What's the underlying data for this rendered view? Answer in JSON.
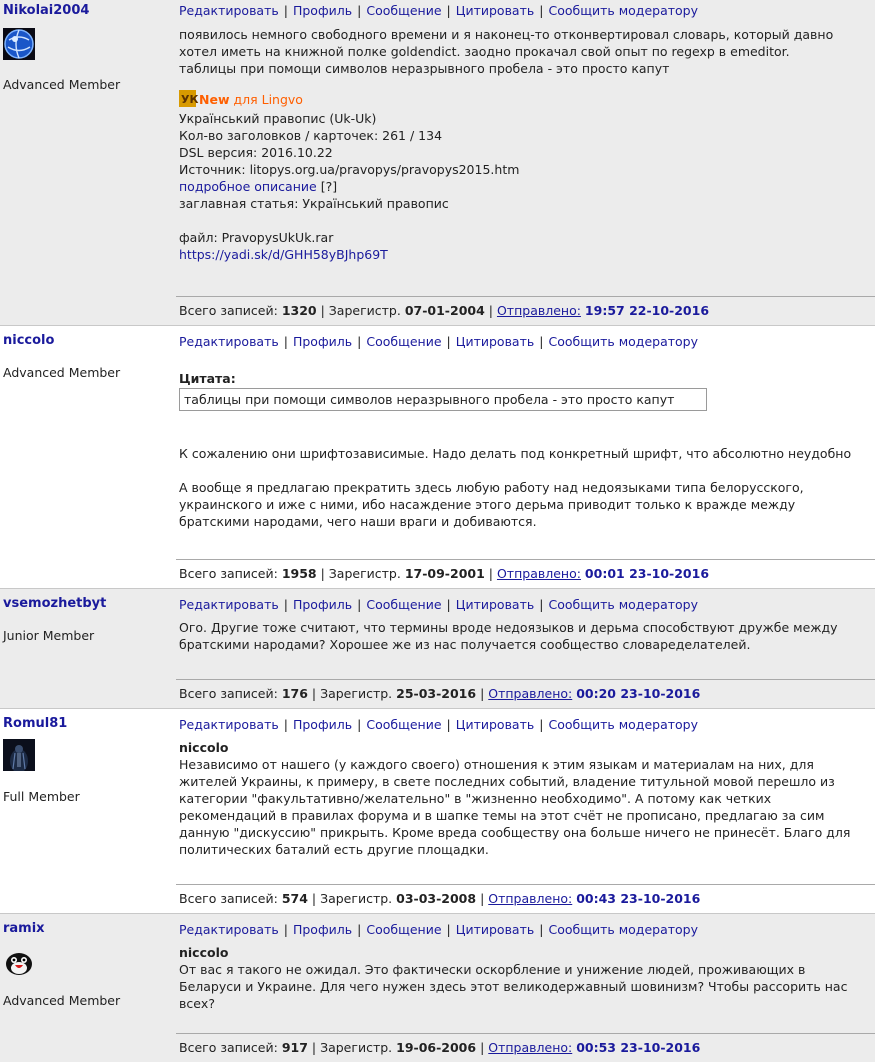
{
  "actions": [
    "Редактировать",
    "Профиль",
    "Сообщение",
    "Цитировать",
    "Сообщить модератору"
  ],
  "labels": {
    "total": "Всего записей:",
    "registered": "Зарегистр.",
    "sent": "Отправлено:",
    "quote_title": "Цитата:"
  },
  "posts": [
    {
      "author": "Nikolai2004",
      "rank": "Advanced Member",
      "avatar": "globe-avatar",
      "lines": [
        "появилось немного свободного времени и я наконец-то отконвертировал словарь, который давно",
        "хотел иметь на книжной полке goldendict. заодно прокачал свой опыт по regexp в emeditor.",
        "таблицы при помощи символов неразрывного пробела - это просто капут"
      ],
      "dict": {
        "new": "New",
        "for": "для Lingvo",
        "name": "Український правопис (Uk-Uk)",
        "headwords": "Кол-во заголовков / карточек: 261 / 134",
        "dsl": "DSL версия: 2016.10.22",
        "source": "Источник: litopys.org.ua/pravopys/pravopys2015.htm",
        "details_link": "подробное описание",
        "details_help": "[?]",
        "title_article": "заглавная статья: Український правопис",
        "file": "файл: PravopysUkUk.rar",
        "url": "https://yadi.sk/d/GHH58yBJhp69T"
      },
      "total": "1320",
      "registered": "07-01-2004",
      "sent": "19:57 22-10-2016"
    },
    {
      "author": "niccolo",
      "rank": "Advanced Member",
      "quote": "таблицы при помощи символов неразрывного пробела - это просто капут",
      "paragraph1": "К сожалению они шрифтозависимые. Надо делать под конкретный шрифт, что абсолютно неудобно",
      "paragraph2": [
        "А вообще я предлагаю прекратить здесь любую работу над недоязыками типа белорусского,",
        "украинского и иже с ними, ибо насаждение этого дерьма приводит только к вражде между",
        "братскими народами, чего наши враги и добиваются."
      ],
      "total": "1958",
      "registered": "17-09-2001",
      "sent": "00:01 23-10-2016"
    },
    {
      "author": "vsemozhetbyt",
      "rank": "Junior Member",
      "lines": [
        "Ого. Другие тоже считают, что термины вроде недоязыков и дерьма способствуют дружбе между",
        "братскими народами? Хорошее же из нас получается сообщество словаределателей."
      ],
      "total": "176",
      "registered": "25-03-2016",
      "sent": "00:20 23-10-2016"
    },
    {
      "author": "Romul81",
      "rank": "Full Member",
      "avatar": "dark-figure-avatar",
      "addressee": "niccolo",
      "lines": [
        "Независимо от нашего (у каждого своего) отношения к этим языкам и материалам на них, для",
        "жителей Украины, к примеру, в свете последних событий, владение титульной мовой перешло из",
        "категории \"факультативно/желательно\" в \"жизненно необходимо\". А потому как четких",
        "рекомендаций в правилах форума и в шапке темы на этот счёт не прописано, предлагаю за сим",
        "данную \"дискуссию\" прикрыть. Кроме вреда сообществу она больше ничего не принесёт. Благо для",
        "политических баталий есть другие площадки."
      ],
      "total": "574",
      "registered": "03-03-2008",
      "sent": "00:43 23-10-2016"
    },
    {
      "author": "ramix",
      "rank": "Advanced Member",
      "avatar": "penguin-avatar",
      "addressee": "niccolo",
      "lines": [
        "От вас я такого не ожидал. Это фактически оскорбление и унижение людей, проживающих в",
        "Беларуси и Украине. Для чего нужен здесь этот великодержавный шовинизм? Чтобы рассорить нас",
        "всех?"
      ],
      "total": "917",
      "registered": "19-06-2006",
      "sent": "00:53 23-10-2016"
    }
  ]
}
